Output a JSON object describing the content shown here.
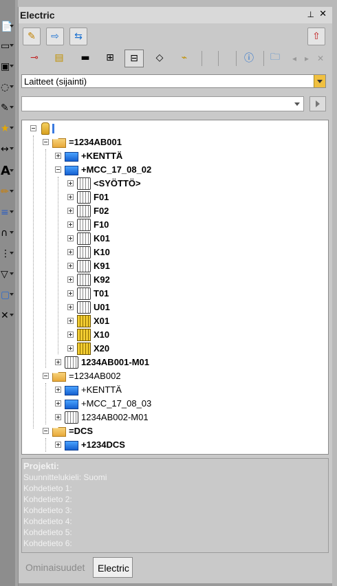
{
  "panel": {
    "title": "Electric",
    "pin_glyph": "ᵖ",
    "close_glyph": "✕"
  },
  "left_toolbar": {
    "icons": [
      "document-icon",
      "window-icon",
      "frame-icon",
      "lasso-icon",
      "pen-icon",
      "star-icon",
      "dimension-icon",
      "text-icon",
      "pencil-icon",
      "layers-icon",
      "magnet-icon",
      "grid-icon",
      "filter-icon",
      "monitor-icon",
      "cross-icon"
    ]
  },
  "toolbar1": {
    "buttons": [
      "edit-icon",
      "export-icon",
      "import-icon"
    ],
    "right_button": "cabinet-upload-icon"
  },
  "toolbar2": {
    "buttons": [
      "wire-icon",
      "layers-stack-icon",
      "component-icon",
      "device-frame-icon",
      "device-frame-selected-icon",
      "diamond-icon",
      "tag-icon",
      "info-icon",
      "new-folder-icon"
    ],
    "nav_glyphs": [
      "◂",
      "▸",
      "✕"
    ]
  },
  "view_selector": {
    "value": "Laitteet (sijainti)"
  },
  "search": {
    "value": ""
  },
  "tree": {
    "root_label": "",
    "nodes": [
      {
        "label": "=1234AB001"
      },
      {
        "label": "+KENTTÄ"
      },
      {
        "label": "+MCC_17_08_02"
      },
      {
        "label": "<SYÖTTÖ>"
      },
      {
        "label": "F01"
      },
      {
        "label": "F02"
      },
      {
        "label": "F10"
      },
      {
        "label": "K01"
      },
      {
        "label": "K10"
      },
      {
        "label": "K91"
      },
      {
        "label": "K92"
      },
      {
        "label": "T01"
      },
      {
        "label": "U01"
      },
      {
        "label": "X01"
      },
      {
        "label": "X10"
      },
      {
        "label": "X20"
      },
      {
        "label": "1234AB001-M01"
      },
      {
        "label": "=1234AB002"
      },
      {
        "label": "+KENTTÄ"
      },
      {
        "label": "+MCC_17_08_03"
      },
      {
        "label": "1234AB002-M01"
      },
      {
        "label": "=DCS"
      },
      {
        "label": "+1234DCS"
      }
    ]
  },
  "properties": {
    "heading": "Projekti:",
    "lines": [
      "Suunnittelukieli: Suomi",
      "Kohdetieto 1:",
      "Kohdetieto 2:",
      "Kohdetieto 3:",
      "Kohdetieto 4:",
      "Kohdetieto 5:",
      "Kohdetieto 6:"
    ]
  },
  "tabs": {
    "properties": "Ominaisuudet",
    "electric": "Electric"
  },
  "colors": {
    "folder_yellow": "#e8a93a",
    "folder_blue": "#1560d0",
    "terminal_yellow": "#f2cd32",
    "combo_accent": "#f0c040"
  }
}
